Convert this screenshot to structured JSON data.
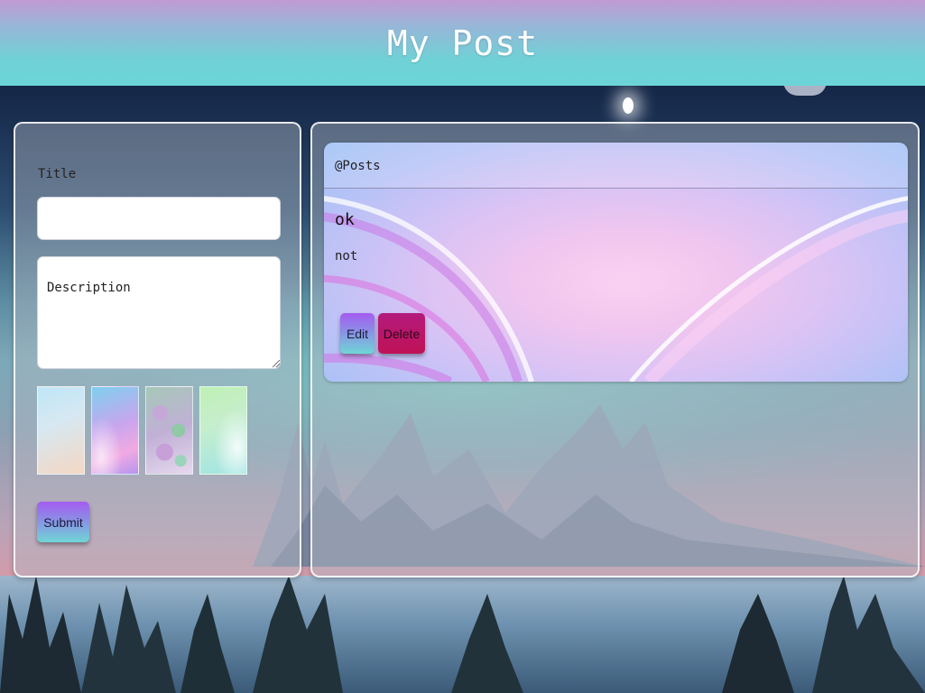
{
  "header": {
    "title": "My Post"
  },
  "form": {
    "title_label": "Title",
    "title_value": "",
    "description_placeholder": "Description",
    "description_value": "",
    "background_options": [
      "pastel-blue-peach",
      "purple-pink-waves",
      "bokeh-green-purple",
      "mint-light-swirl"
    ],
    "submit_label": "Submit"
  },
  "posts": {
    "header": "@Posts",
    "items": [
      {
        "title": "ok",
        "description": "not",
        "edit_label": "Edit",
        "delete_label": "Delete"
      }
    ]
  },
  "colors": {
    "header_top": "#c19ad2",
    "header_bottom": "#6cd5d8",
    "button_gradient_top": "#a45cf0",
    "button_gradient_bottom": "#6fd6d6",
    "delete_button": "#b31a7c"
  }
}
